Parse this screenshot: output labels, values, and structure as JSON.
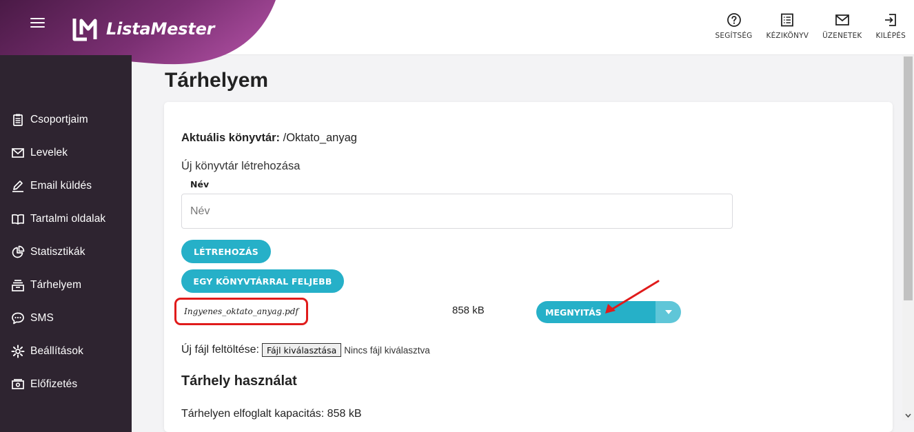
{
  "header": {
    "brand": "ListaMester",
    "menu_icon": "hamburger-icon",
    "actions": [
      {
        "label": "SEGÍTSÉG",
        "icon": "help-icon"
      },
      {
        "label": "KÉZIKÖNYV",
        "icon": "manual-icon"
      },
      {
        "label": "ÜZENETEK",
        "icon": "mail-icon"
      },
      {
        "label": "KILÉPÉS",
        "icon": "logout-icon"
      }
    ]
  },
  "sidebar": {
    "items": [
      {
        "label": "Csoportjaim",
        "icon": "clipboard-icon"
      },
      {
        "label": "Levelek",
        "icon": "envelope-icon"
      },
      {
        "label": "Email küldés",
        "icon": "pencil-icon"
      },
      {
        "label": "Tartalmi oldalak",
        "icon": "book-icon"
      },
      {
        "label": "Statisztikák",
        "icon": "pie-chart-icon"
      },
      {
        "label": "Tárhelyem",
        "icon": "storage-icon"
      },
      {
        "label": "SMS",
        "icon": "chat-icon"
      },
      {
        "label": "Beállítások",
        "icon": "gear-icon"
      },
      {
        "label": "Előfizetés",
        "icon": "subscription-icon"
      }
    ]
  },
  "main": {
    "title": "Tárhelyem",
    "current_dir_label": "Aktuális könyvtár:",
    "current_dir_value": " /Oktato_anyag",
    "new_dir_title": "Új könyvtár létrehozása",
    "name_label": "Név",
    "name_placeholder": "Név",
    "create_button": "LÉTREHOZÁS",
    "up_button": "EGY KÖNYVTÁRRAL FELJEBB",
    "file": {
      "name": "Ingyenes_oktato_anyag.pdf",
      "size": "858 kB",
      "open_button": "MEGNYITÁS"
    },
    "upload_label": "Új fájl feltöltése:",
    "choose_file_button": "Fájl kiválasztása",
    "no_file_text": "Nincs fájl kiválasztva",
    "usage_title": "Tárhely használat",
    "capacity_text": "Tárhelyen elfoglalt kapacitás: 858 kB"
  },
  "colors": {
    "accent": "#26b0c8",
    "sidebar_bg": "#2e2430",
    "highlight": "#e01b1b"
  }
}
